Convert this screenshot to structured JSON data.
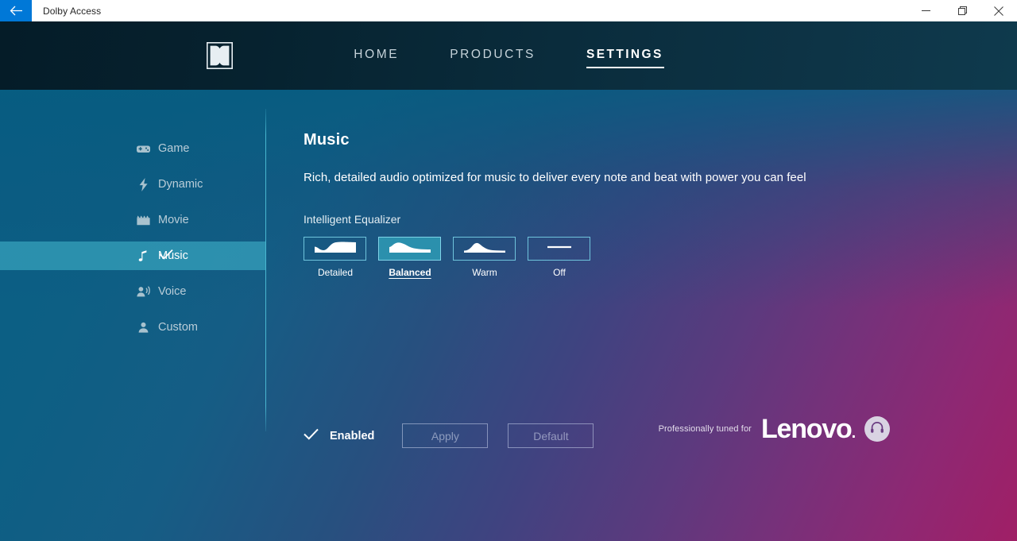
{
  "titlebar": {
    "back_icon": "back-arrow-icon",
    "app_title": "Dolby Access",
    "minimize_label": "minimize-icon",
    "restore_label": "restore-icon",
    "close_label": "close-icon",
    "accent_color": "#0078d7"
  },
  "nav": {
    "logo_name": "dolby-double-d-logo",
    "items": [
      {
        "label": "HOME",
        "active": false
      },
      {
        "label": "PRODUCTS",
        "active": false
      },
      {
        "label": "SETTINGS",
        "active": true
      }
    ]
  },
  "sidebar": {
    "items": [
      {
        "label": "Game",
        "icon": "gamepad-icon",
        "selected": false
      },
      {
        "label": "Dynamic",
        "icon": "lightning-bolt-icon",
        "selected": false
      },
      {
        "label": "Movie",
        "icon": "clapperboard-icon",
        "selected": false
      },
      {
        "label": "Music",
        "icon": "music-note-icon",
        "selected": true
      },
      {
        "label": "Voice",
        "icon": "voice-person-icon",
        "selected": false
      },
      {
        "label": "Custom",
        "icon": "person-icon",
        "selected": false
      }
    ]
  },
  "main": {
    "title": "Music",
    "description": "Rich, detailed audio optimized for music to deliver every note and beat with power you can feel",
    "equalizer": {
      "section_label": "Intelligent Equalizer",
      "options": [
        {
          "label": "Detailed",
          "curve": "detailed-curve-icon",
          "selected": false
        },
        {
          "label": "Balanced",
          "curve": "balanced-curve-icon",
          "selected": true
        },
        {
          "label": "Warm",
          "curve": "warm-curve-icon",
          "selected": false
        },
        {
          "label": "Off",
          "curve": "flat-line-icon",
          "selected": false
        }
      ]
    }
  },
  "footer": {
    "enabled_label": "Enabled",
    "enabled_check_icon": "check-icon",
    "apply_label": "Apply",
    "default_label": "Default"
  },
  "brand": {
    "tagline": "Professionally tuned for",
    "name": "Lenovo",
    "name_dot": ".",
    "badge_icon": "headphones-icon"
  },
  "theme": {
    "accent_cyan": "#6fc4dc",
    "selected_teal": "#38a4be",
    "nav_dark": "#062230",
    "gradient_start": "#0a5f85",
    "gradient_end": "#a01f66"
  }
}
